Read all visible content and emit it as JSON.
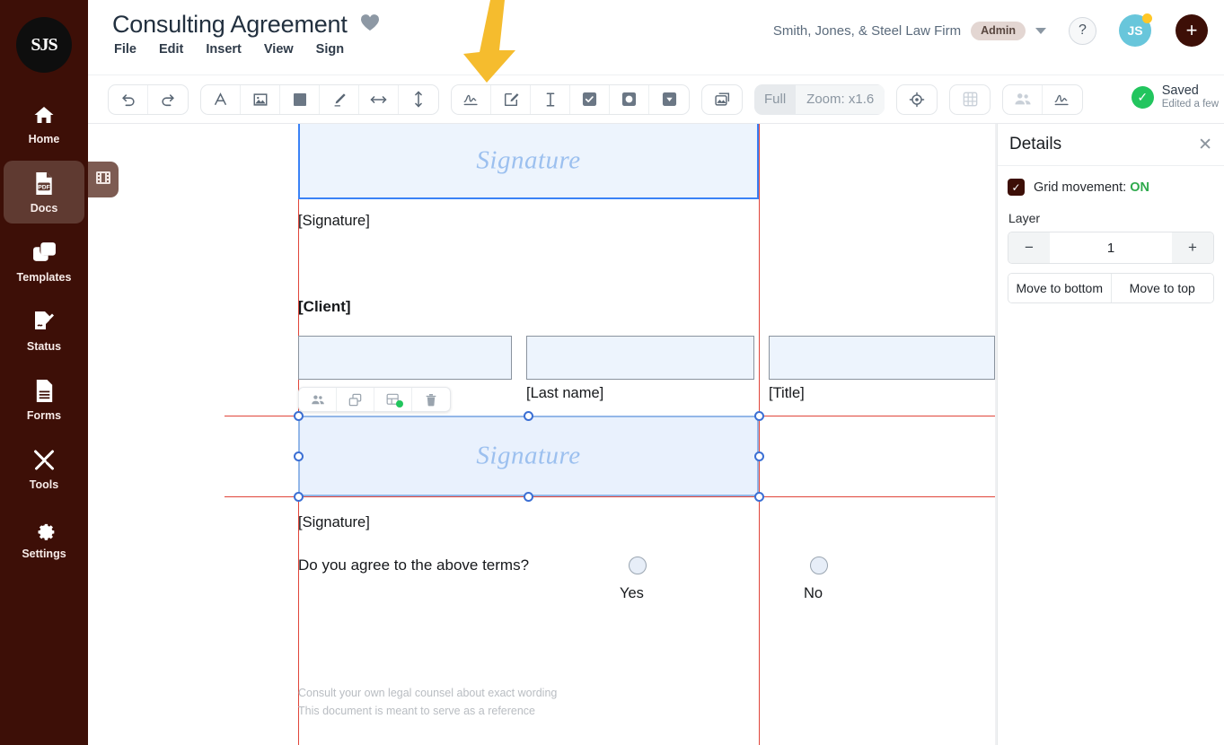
{
  "sidebar": {
    "logo_text": "SJS",
    "items": [
      {
        "label": "Home",
        "icon": "home-icon",
        "active": false
      },
      {
        "label": "Docs",
        "icon": "pdf-file-icon",
        "active": true
      },
      {
        "label": "Templates",
        "icon": "copy-squares-icon",
        "active": false
      },
      {
        "label": "Status",
        "icon": "sign-document-icon",
        "active": false
      },
      {
        "label": "Forms",
        "icon": "form-lines-icon",
        "active": false
      },
      {
        "label": "Tools",
        "icon": "wrench-screwdriver-icon",
        "active": false
      },
      {
        "label": "Settings",
        "icon": "gear-icon",
        "active": false
      }
    ],
    "edge_tab_icon": "filmstrip-icon"
  },
  "header": {
    "document_title": "Consulting Agreement",
    "favorite_icon": "heart-icon",
    "menu": [
      "File",
      "Edit",
      "Insert",
      "View",
      "Sign"
    ],
    "org_name": "Smith, Jones, & Steel Law Firm",
    "role_badge": "Admin",
    "dropdown_icon": "chevron-down-icon",
    "help_label": "?",
    "avatar_initials": "JS",
    "add_label": "+",
    "accent_brand_color": "#3d0f07",
    "avatar_color": "#68c6db",
    "badge_dot_color": "#ffc727"
  },
  "toolbar": {
    "groups": [
      {
        "name": "history",
        "buttons": [
          {
            "name": "undo-button",
            "icon": "undo-icon"
          },
          {
            "name": "redo-button",
            "icon": "redo-icon"
          }
        ]
      },
      {
        "name": "insert",
        "buttons": [
          {
            "name": "text-tool-button",
            "icon": "text-a-icon"
          },
          {
            "name": "image-tool-button",
            "icon": "image-icon"
          },
          {
            "name": "shape-tool-button",
            "icon": "filled-square-icon"
          },
          {
            "name": "highlighter-tool-button",
            "icon": "marker-pen-icon"
          },
          {
            "name": "horizontal-resize-button",
            "icon": "arrows-horizontal-icon"
          },
          {
            "name": "vertical-resize-button",
            "icon": "arrows-vertical-icon"
          }
        ]
      },
      {
        "name": "fields",
        "buttons": [
          {
            "name": "signature-field-button",
            "icon": "signature-icon"
          },
          {
            "name": "initials-field-button",
            "icon": "pen-square-icon"
          },
          {
            "name": "text-field-button",
            "icon": "text-cursor-icon"
          },
          {
            "name": "checkbox-field-button",
            "icon": "checkbox-icon"
          },
          {
            "name": "radio-field-button",
            "icon": "radio-filled-icon"
          },
          {
            "name": "dropdown-field-button",
            "icon": "dropdown-icon"
          }
        ]
      },
      {
        "name": "pages",
        "buttons": [
          {
            "name": "page-manager-button",
            "icon": "stacked-images-icon"
          }
        ]
      }
    ],
    "zoom": {
      "mode_label": "Full",
      "value_label": "Zoom: x1.6"
    },
    "after_zoom_buttons": [
      {
        "name": "fit-target-button",
        "icon": "crosshair-icon"
      },
      {
        "name": "grid-toggle-button",
        "icon": "grid-icon",
        "disabled": true
      }
    ],
    "recipients_group": [
      {
        "name": "recipients-button",
        "icon": "people-group-icon"
      },
      {
        "name": "send-for-signature-button",
        "icon": "signature-icon"
      }
    ],
    "save_status": {
      "title": "Saved",
      "subtitle": "Edited a few"
    }
  },
  "annotation": {
    "arrow_color": "#f5bc2e",
    "points_to": "signature-field-button"
  },
  "document": {
    "top_signature_placeholder": "Signature",
    "top_signature_label": "[Signature]",
    "client_heading": "[Client]",
    "fields": [
      {
        "label": "",
        "name": "first-name-field"
      },
      {
        "label": "[Last name]",
        "name": "last-name-field"
      },
      {
        "label": "[Title]",
        "name": "title-field"
      }
    ],
    "selected_signature_placeholder": "Signature",
    "selected_signature_label": "[Signature]",
    "question": "Do you agree to the above terms?",
    "choices": [
      "Yes",
      "No"
    ],
    "footnotes": [
      "Consult your own legal counsel about exact wording",
      "This document is meant to serve as a reference"
    ],
    "float_tools": [
      {
        "name": "assign-recipient-button",
        "icon": "people-group-icon"
      },
      {
        "name": "duplicate-field-button",
        "icon": "copy-icon"
      },
      {
        "name": "field-settings-button",
        "icon": "layout-plus-icon"
      },
      {
        "name": "delete-field-button",
        "icon": "trash-icon"
      }
    ],
    "selection_handle_color": "#3b6fd4",
    "guide_color": "#e0453a",
    "field_fill_color": "#edf4fd"
  },
  "details_panel": {
    "title": "Details",
    "close_icon": "close-icon",
    "grid_movement_label": "Grid movement:",
    "grid_movement_value": "ON",
    "layer_label": "Layer",
    "layer_value": "1",
    "decrement_label": "−",
    "increment_label": "+",
    "move_bottom_label": "Move to bottom",
    "move_top_label": "Move to top",
    "on_color": "#2faa4d"
  }
}
